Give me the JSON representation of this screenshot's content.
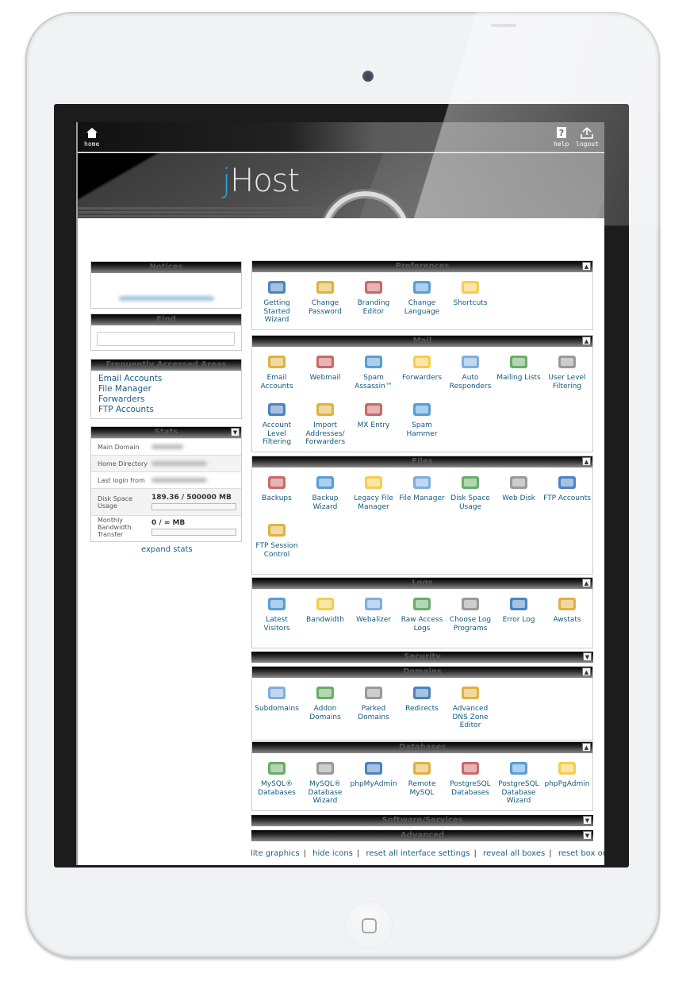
{
  "topbar": {
    "home_label": "home",
    "help_label": "help",
    "logout_label": "logout"
  },
  "banner": {
    "logo_prefix": "j",
    "logo_rest": "Host"
  },
  "sidebar": {
    "notices": {
      "title": "Notices",
      "message": "Search Engine Marketing"
    },
    "find": {
      "title": "Find",
      "value": "",
      "placeholder": ""
    },
    "frequent": {
      "title": "Frequently Accessed Areas",
      "links": [
        "Email Accounts",
        "File Manager",
        "Forwarders",
        "FTP Accounts"
      ]
    },
    "stats": {
      "title": "Stats",
      "rows": [
        {
          "label": "Main Domain",
          "value": "(blurred)"
        },
        {
          "label": "Home Directory",
          "value": "(blurred)"
        },
        {
          "label": "Last login from",
          "value": "(blurred)"
        },
        {
          "label": "Disk Space Usage",
          "value": "189.36 / 500000 MB",
          "progress": 0.0004
        },
        {
          "label": "Monthly Bandwidth Transfer",
          "value": "0 / ∞ MB",
          "progress": 0
        }
      ],
      "expand_label": "expand stats"
    }
  },
  "sections": [
    {
      "title": "Preferences",
      "collapsed": false,
      "items": [
        {
          "label": "Getting Started Wizard",
          "icon": "play-icon"
        },
        {
          "label": "Change Password",
          "icon": "lock-password-icon"
        },
        {
          "label": "Branding Editor",
          "icon": "palette-icon"
        },
        {
          "label": "Change Language",
          "icon": "language-icon"
        },
        {
          "label": "Shortcuts",
          "icon": "star-icon"
        }
      ]
    },
    {
      "title": "Mail",
      "collapsed": false,
      "items": [
        {
          "label": "Email Accounts",
          "icon": "envelope-icon"
        },
        {
          "label": "Webmail",
          "icon": "globe-mail-icon"
        },
        {
          "label": "Spam Assassin™",
          "icon": "spamassassin-icon"
        },
        {
          "label": "Forwarders",
          "icon": "forward-mail-icon"
        },
        {
          "label": "Auto Responders",
          "icon": "auto-responder-icon"
        },
        {
          "label": "Mailing Lists",
          "icon": "mailing-list-icon"
        },
        {
          "label": "User Level Filtering",
          "icon": "user-filter-icon"
        },
        {
          "label": "Account Level Filtering",
          "icon": "account-filter-icon"
        },
        {
          "label": "Import Addresses/ Forwarders",
          "icon": "import-icon"
        },
        {
          "label": "MX Entry",
          "icon": "mx-entry-icon"
        },
        {
          "label": "Spam Hammer",
          "icon": "hammer-icon"
        }
      ]
    },
    {
      "title": "Files",
      "collapsed": false,
      "items": [
        {
          "label": "Backups",
          "icon": "disk-icon"
        },
        {
          "label": "Backup Wizard",
          "icon": "backup-wizard-icon"
        },
        {
          "label": "Legacy File Manager",
          "icon": "folder-icon"
        },
        {
          "label": "File Manager",
          "icon": "folder-icon"
        },
        {
          "label": "Disk Space Usage",
          "icon": "disk-usage-icon"
        },
        {
          "label": "Web Disk",
          "icon": "web-disk-icon"
        },
        {
          "label": "FTP Accounts",
          "icon": "ftp-icon"
        },
        {
          "label": "FTP Session Control",
          "icon": "ftp-session-icon"
        }
      ]
    },
    {
      "title": "Logs",
      "collapsed": false,
      "items": [
        {
          "label": "Latest Visitors",
          "icon": "visitors-icon"
        },
        {
          "label": "Bandwidth",
          "icon": "bandwidth-icon"
        },
        {
          "label": "Webalizer",
          "icon": "bar-chart-icon"
        },
        {
          "label": "Raw Access Logs",
          "icon": "log-icon"
        },
        {
          "label": "Choose Log Programs",
          "icon": "log-programs-icon"
        },
        {
          "label": "Error Log",
          "icon": "error-log-icon"
        },
        {
          "label": "Awstats",
          "icon": "awstats-icon"
        }
      ]
    },
    {
      "title": "Security",
      "collapsed": true,
      "items": []
    },
    {
      "title": "Domains",
      "collapsed": false,
      "items": [
        {
          "label": "Subdomains",
          "icon": "subdomains-icon"
        },
        {
          "label": "Addon Domains",
          "icon": "addon-domain-icon"
        },
        {
          "label": "Parked Domains",
          "icon": "parked-domain-icon"
        },
        {
          "label": "Redirects",
          "icon": "redirect-icon"
        },
        {
          "label": "Advanced DNS Zone Editor",
          "icon": "dns-editor-icon"
        }
      ]
    },
    {
      "title": "Databases",
      "collapsed": false,
      "items": [
        {
          "label": "MySQL® Databases",
          "icon": "mysql-icon"
        },
        {
          "label": "MySQL® Database Wizard",
          "icon": "mysql-wizard-icon"
        },
        {
          "label": "phpMyAdmin",
          "icon": "phpmyadmin-icon"
        },
        {
          "label": "Remote MySQL",
          "icon": "remote-mysql-icon"
        },
        {
          "label": "PostgreSQL Databases",
          "icon": "postgresql-icon"
        },
        {
          "label": "PostgreSQL Database Wizard",
          "icon": "postgresql-wizard-icon"
        },
        {
          "label": "phpPgAdmin",
          "icon": "phppgadmin-icon"
        }
      ]
    },
    {
      "title": "Software/Services",
      "collapsed": true,
      "items": []
    },
    {
      "title": "Advanced",
      "collapsed": true,
      "items": []
    }
  ],
  "footer": {
    "links": [
      "lite graphics",
      "hide icons",
      "reset all interface settings",
      "reveal all boxes",
      "reset box order"
    ]
  },
  "colors": {
    "link": "#1a5d85",
    "logo_accent": "#2b9fd2"
  }
}
